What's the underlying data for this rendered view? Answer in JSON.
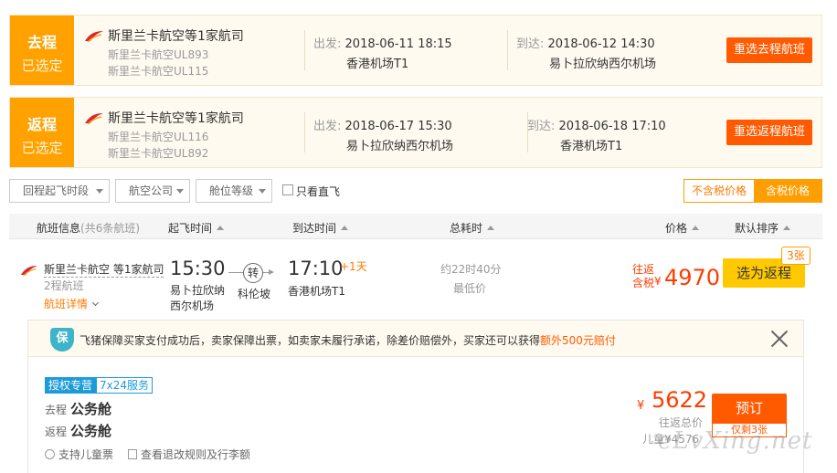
{
  "top_cut": "",
  "outbound": {
    "tag": "去程",
    "status": "已选定",
    "airline": "斯里兰卡航空等1家航司",
    "flight1": "斯里兰卡航空UL893",
    "flight2": "斯里兰卡航空UL115",
    "dep_label": "出发:",
    "dep_datetime": "2018-06-11 18:15",
    "dep_airport": "香港机场T1",
    "arr_label": "到达:",
    "arr_datetime": "2018-06-12 14:30",
    "arr_airport": "易卜拉欣纳西尔机场",
    "reselect": "重选去程航班"
  },
  "inbound": {
    "tag": "返程",
    "status": "已选定",
    "airline": "斯里兰卡航空等1家航司",
    "flight1": "斯里兰卡航空UL116",
    "flight2": "斯里兰卡航空UL892",
    "dep_label": "出发:",
    "dep_datetime": "2018-06-17 15:30",
    "dep_airport": "易卜拉欣纳西尔机场",
    "arr_label": "到达:",
    "arr_datetime": "2018-06-18 17:10",
    "arr_airport": "香港机场T1",
    "reselect": "重选返程航班"
  },
  "filters": {
    "depart_period": "回程起飞时段",
    "airline": "航空公司",
    "cabin": "舱位等级",
    "direct_only": "只看直飞",
    "tax_excluded": "不含税价格",
    "tax_included": "含税价格"
  },
  "header": {
    "flight_info": "航班信息",
    "count": "(共6条航班)",
    "depart_time": "起飞时间",
    "arrive_time": "到达时间",
    "duration": "总耗时",
    "price": "价格",
    "default_sort": "默认排序"
  },
  "flight": {
    "airline": "斯里兰卡航空 等1家航司",
    "stops": "2程航班",
    "detail": "航班详情",
    "dep_time": "15:30",
    "dep_airport": "易卜拉欣纳西尔机场",
    "transfer": "转",
    "via": "科伦坡",
    "arr_time": "17:10",
    "day_plus": "+1天",
    "arr_airport": "香港机场T1",
    "duration": "约22时40分",
    "lowest": "最低价",
    "price_lbl1": "往返",
    "price_lbl2": "含税",
    "yen": "¥",
    "price": "4970",
    "select": "选为返程",
    "tickets": "3张"
  },
  "panel": {
    "shield": "保",
    "notice": "飞猪保障买家支付成功后，卖家保障出票，如卖家未履行承诺，除差价赔偿外，买家还可以获得",
    "notice_hl": "额外500元赔付",
    "tag1": "授权专营",
    "tag2": "7x24服务",
    "go_label": "去程",
    "go_cabin": "公务舱",
    "back_label": "返程",
    "back_cabin": "公务舱",
    "child": "支持儿童票",
    "rules": "查看退改规则及行李额",
    "yen": "¥",
    "price": "5622",
    "total": "往返总价",
    "child_price": "儿童¥4576",
    "book": "预订",
    "left": "仅剩3张"
  },
  "watermark": "eLvXing.net"
}
